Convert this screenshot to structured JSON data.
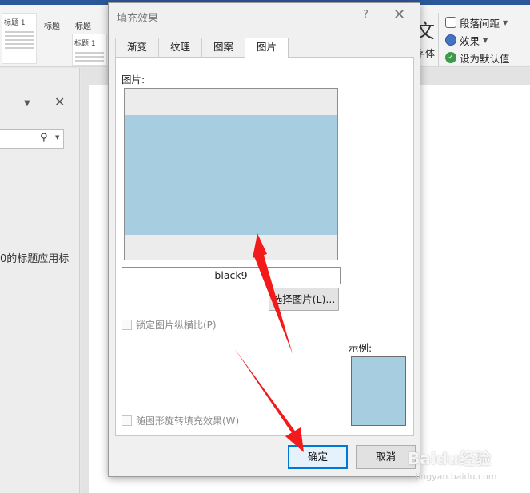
{
  "background": {
    "ribbon": {
      "styles": [
        {
          "label": "标题",
          "heading": "标题 1"
        },
        {
          "label": "标题",
          "heading": "标题 1"
        }
      ],
      "font_glyph": "文",
      "font_label": "字体",
      "paragraph_spacing": "段落间距",
      "effects": "效果",
      "set_default": "设为默认值"
    },
    "nav_pane": {
      "text_fragment": "0的标题应用标"
    }
  },
  "dialog": {
    "title": "填充效果",
    "help": "?",
    "close": "✕",
    "tabs": [
      {
        "label": "渐变",
        "active": false
      },
      {
        "label": "纹理",
        "active": false
      },
      {
        "label": "图案",
        "active": false
      },
      {
        "label": "图片",
        "active": true
      }
    ],
    "picture_label": "图片:",
    "picture_name": "black9",
    "select_picture_button": "选择图片(L)...",
    "lock_aspect_label": "锁定图片纵横比(P)",
    "rotate_with_shape_label": "随图形旋转填充效果(W)",
    "sample_label": "示例:",
    "ok_button": "确定",
    "cancel_button": "取消",
    "fill_color": "#a7cde0"
  },
  "watermark": {
    "logo": "Baidu经验",
    "url": "jingyan.baidu.com"
  }
}
